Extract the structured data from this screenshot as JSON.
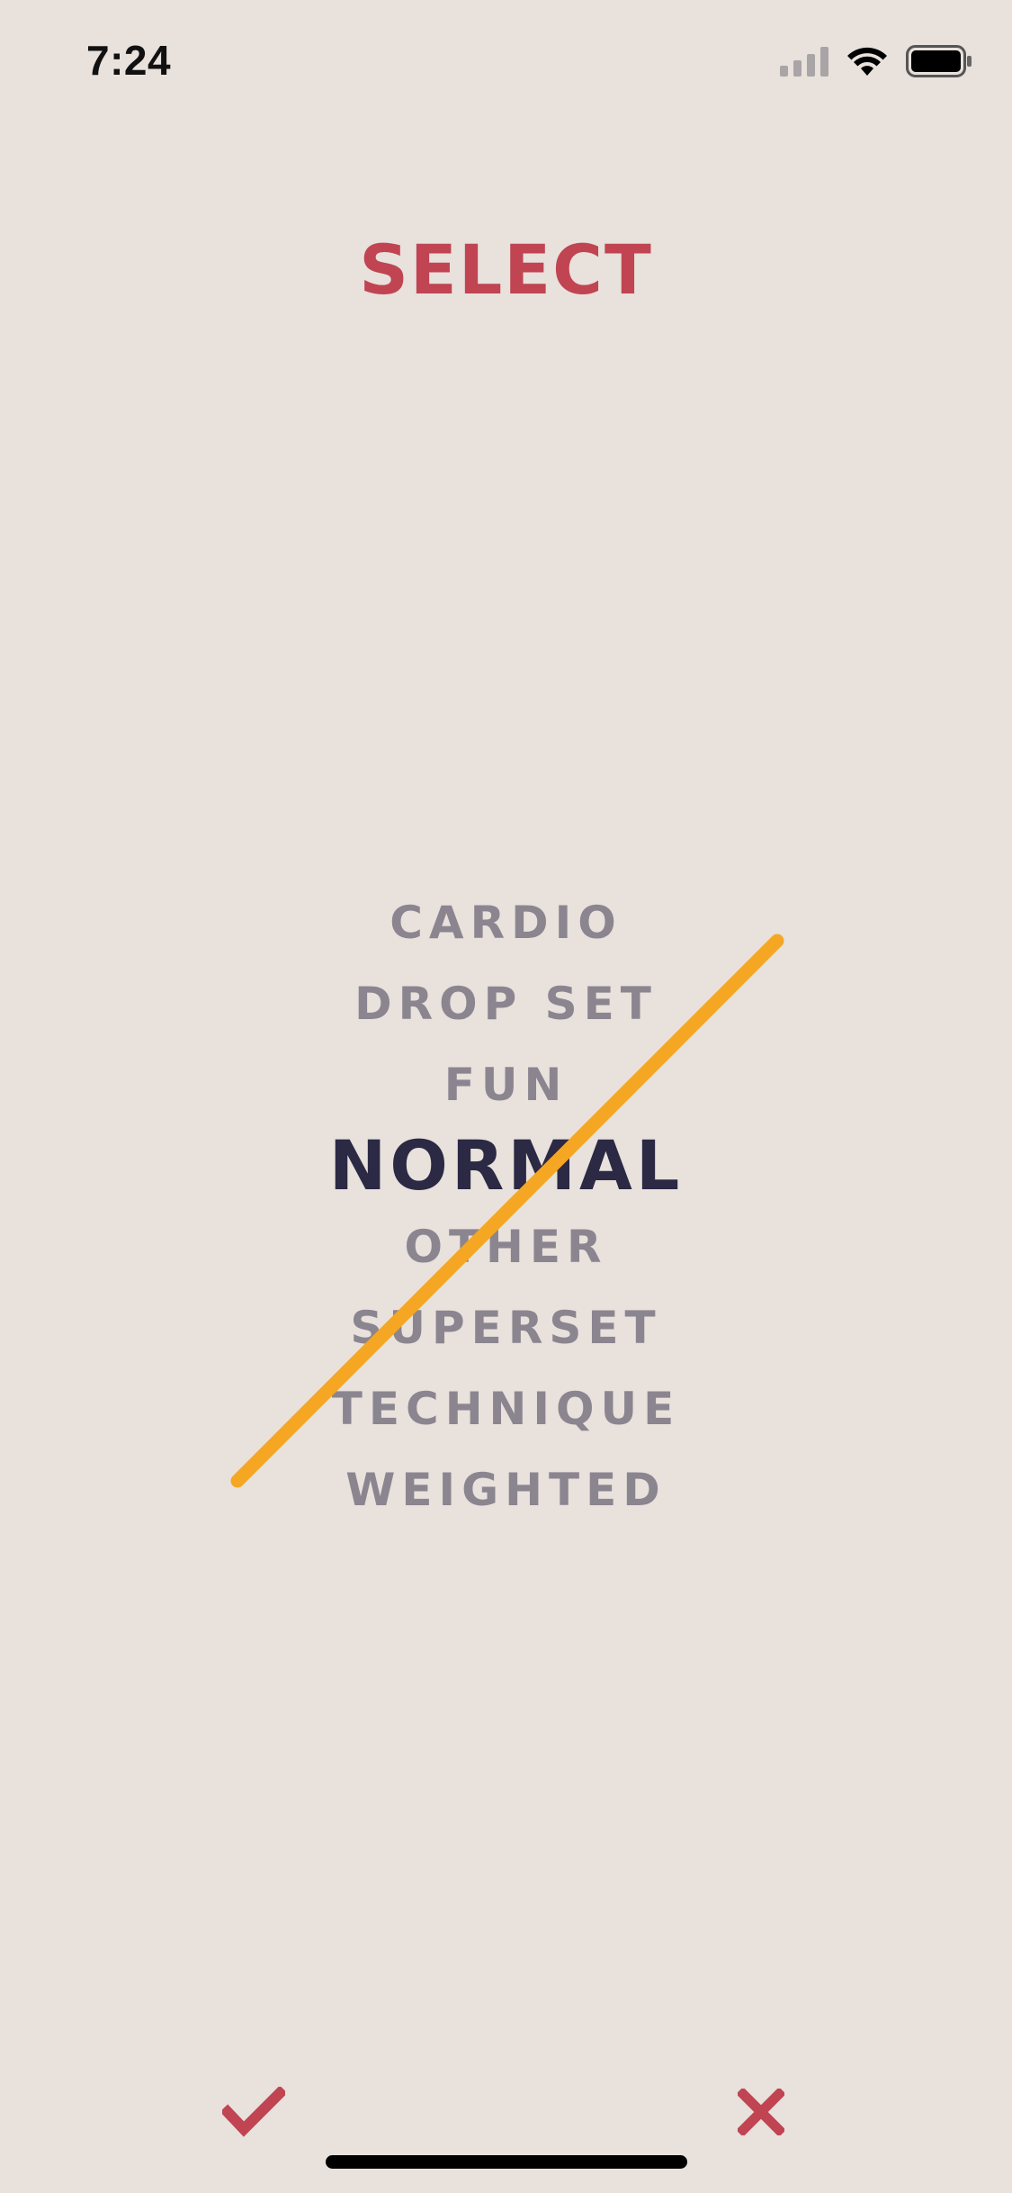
{
  "status_bar": {
    "time": "7:24",
    "icons": [
      "cellular-signal-icon",
      "wifi-icon",
      "battery-icon"
    ]
  },
  "title": "SELECT",
  "picker": {
    "options": [
      "CARDIO",
      "DROP SET",
      "FUN",
      "NORMAL",
      "OTHER",
      "SUPERSET",
      "TECHNIQUE",
      "WEIGHTED"
    ],
    "selected_index": 3
  },
  "actions": {
    "confirm_icon": "checkmark-icon",
    "cancel_icon": "close-icon"
  },
  "colors": {
    "background": "#e8e1dc",
    "accent": "#c04452",
    "selected_text": "#2b2944",
    "unselected_text": "#8b8590",
    "slash": "#f5a623"
  }
}
